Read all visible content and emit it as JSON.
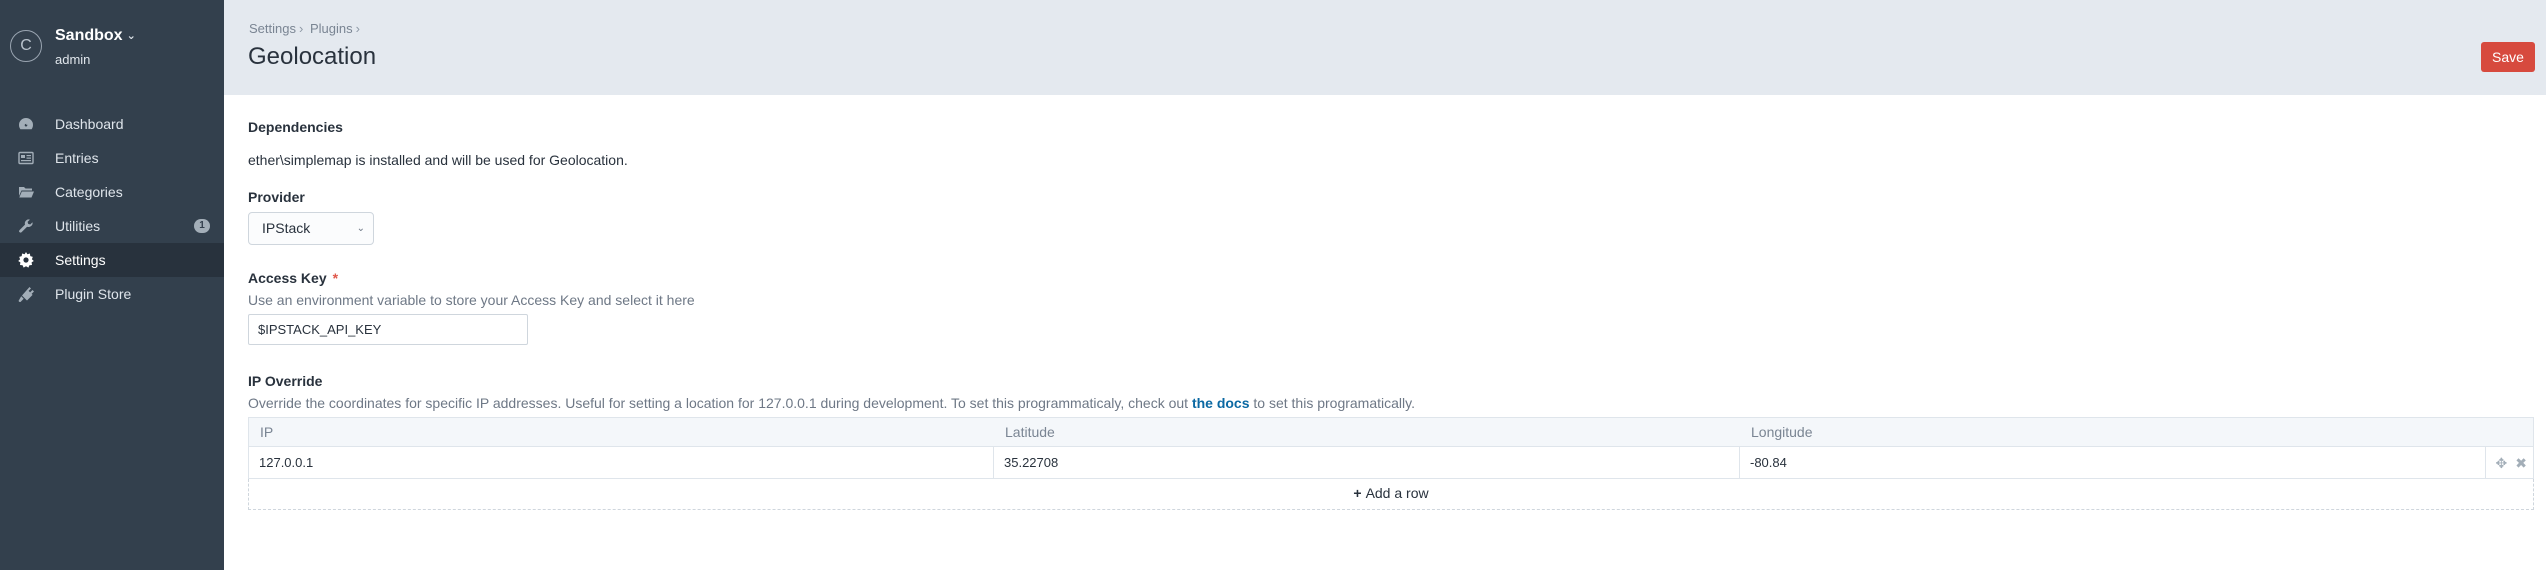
{
  "site": {
    "icon_letter": "C",
    "name": "Sandbox",
    "chevron": "⌄",
    "user": "admin"
  },
  "nav": [
    {
      "icon": "dashboard-icon",
      "label": "Dashboard",
      "active": false
    },
    {
      "icon": "entries-icon",
      "label": "Entries",
      "active": false
    },
    {
      "icon": "categories-icon",
      "label": "Categories",
      "active": false
    },
    {
      "icon": "utilities-icon",
      "label": "Utilities",
      "active": false,
      "badge": "1"
    },
    {
      "icon": "settings-icon",
      "label": "Settings",
      "active": true
    },
    {
      "icon": "plugin-store-icon",
      "label": "Plugin Store",
      "active": false
    }
  ],
  "header": {
    "breadcrumbs": [
      "Settings",
      "Plugins"
    ],
    "separator": "›",
    "title": "Geolocation",
    "save_label": "Save"
  },
  "dependencies": {
    "heading": "Dependencies",
    "text": "ether\\simplemap is installed and will be used for Geolocation."
  },
  "provider": {
    "label": "Provider",
    "value": "IPStack"
  },
  "access_key": {
    "label": "Access Key",
    "required_mark": "*",
    "hint": "Use an environment variable to store your Access Key and select it here",
    "value": "$IPSTACK_API_KEY"
  },
  "ip_override": {
    "label": "IP Override",
    "hint_before": "Override the coordinates for specific IP addresses. Useful for setting a location for 127.0.0.1 during development. To set this programmaticaly, check out ",
    "hint_link": "the docs",
    "hint_after": " to set this programatically.",
    "columns": [
      "IP",
      "Latitude",
      "Longitude"
    ],
    "rows": [
      {
        "ip": "127.0.0.1",
        "latitude": "35.22708",
        "longitude": "-80.84"
      }
    ],
    "add_row_label": "Add a row"
  },
  "colors": {
    "sidebar": "#33404d",
    "header": "#e4e9ef",
    "accent": "#d74a3e",
    "link": "#0b69a3"
  }
}
